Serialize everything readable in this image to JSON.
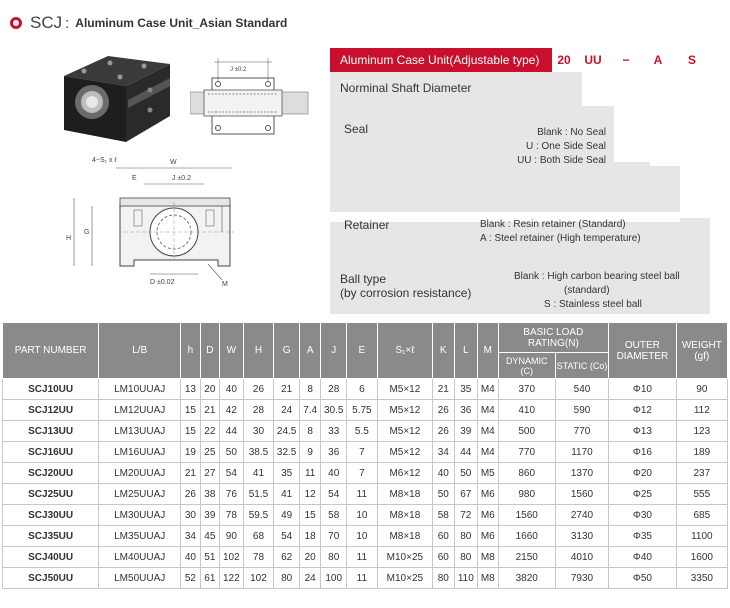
{
  "header": {
    "title": "SCJ",
    "separator": ":",
    "subtitle": "Aluminum Case Unit_Asian Standard"
  },
  "drawing": {
    "labels": {
      "j2": "J ±0.2",
      "four_s": "4−S₁ x ℓ",
      "w": "W",
      "e": "E",
      "j": "J ±0.2",
      "h1": "h ±0.02",
      "g": "G",
      "h": "H",
      "d": "D ±0.02",
      "m": "M"
    }
  },
  "code": {
    "red_label": "Aluminum Case Unit(Adjustable type) SC",
    "segments": [
      "20",
      "UU",
      "−",
      "A",
      "S"
    ],
    "shaft_label": "Norminal Shaft Diameter",
    "seal_label": "Seal",
    "seal_options": [
      "Blank : No Seal",
      "U : One Side Seal",
      "UU : Both Side Seal"
    ],
    "retainer_label": "Retainer",
    "retainer_options": [
      "Blank : Resin retainer (Standard)",
      "A : Steel retainer (High temperature)"
    ],
    "ball_label_1": "Ball type",
    "ball_label_2": "(by corrosion resistance)",
    "ball_options": [
      "Blank : High carbon bearing steel ball",
      "(standard)",
      "S : Stainless steel ball"
    ]
  },
  "table": {
    "headers": {
      "part": "PART NUMBER",
      "lb": "L/B",
      "h": "h",
      "d": "D",
      "w": "W",
      "hh": "H",
      "g": "G",
      "a": "A",
      "j": "J",
      "e": "E",
      "s1": "S₁×ℓ",
      "k": "K",
      "l": "L",
      "m": "M",
      "load": "BASIC LOAD RATING(N)",
      "dynamic": "DYNAMIC (C)",
      "static": "STATIC (Co)",
      "outer": "OUTER DIAMETER",
      "weight": "WEIGHT (gf)"
    },
    "rows": [
      [
        "SCJ10UU",
        "LM10UUAJ",
        "13",
        "20",
        "40",
        "26",
        "21",
        "8",
        "28",
        "6",
        "M5×12",
        "21",
        "35",
        "M4",
        "370",
        "540",
        "Φ10",
        "90"
      ],
      [
        "SCJ12UU",
        "LM12UUAJ",
        "15",
        "21",
        "42",
        "28",
        "24",
        "7.4",
        "30.5",
        "5.75",
        "M5×12",
        "26",
        "36",
        "M4",
        "410",
        "590",
        "Φ12",
        "112"
      ],
      [
        "SCJ13UU",
        "LM13UUAJ",
        "15",
        "22",
        "44",
        "30",
        "24.5",
        "8",
        "33",
        "5.5",
        "M5×12",
        "26",
        "39",
        "M4",
        "500",
        "770",
        "Φ13",
        "123"
      ],
      [
        "SCJ16UU",
        "LM16UUAJ",
        "19",
        "25",
        "50",
        "38.5",
        "32.5",
        "9",
        "36",
        "7",
        "M5×12",
        "34",
        "44",
        "M4",
        "770",
        "1170",
        "Φ16",
        "189"
      ],
      [
        "SCJ20UU",
        "LM20UUAJ",
        "21",
        "27",
        "54",
        "41",
        "35",
        "11",
        "40",
        "7",
        "M6×12",
        "40",
        "50",
        "M5",
        "860",
        "1370",
        "Φ20",
        "237"
      ],
      [
        "SCJ25UU",
        "LM25UUAJ",
        "26",
        "38",
        "76",
        "51.5",
        "41",
        "12",
        "54",
        "11",
        "M8×18",
        "50",
        "67",
        "M6",
        "980",
        "1560",
        "Φ25",
        "555"
      ],
      [
        "SCJ30UU",
        "LM30UUAJ",
        "30",
        "39",
        "78",
        "59.5",
        "49",
        "15",
        "58",
        "10",
        "M8×18",
        "58",
        "72",
        "M6",
        "1560",
        "2740",
        "Φ30",
        "685"
      ],
      [
        "SCJ35UU",
        "LM35UUAJ",
        "34",
        "45",
        "90",
        "68",
        "54",
        "18",
        "70",
        "10",
        "M8×18",
        "60",
        "80",
        "M6",
        "1660",
        "3130",
        "Φ35",
        "1100"
      ],
      [
        "SCJ40UU",
        "LM40UUAJ",
        "40",
        "51",
        "102",
        "78",
        "62",
        "20",
        "80",
        "11",
        "M10×25",
        "60",
        "80",
        "M8",
        "2150",
        "4010",
        "Φ40",
        "1600"
      ],
      [
        "SCJ50UU",
        "LM50UUAJ",
        "52",
        "61",
        "122",
        "102",
        "80",
        "24",
        "100",
        "11",
        "M10×25",
        "80",
        "110",
        "M8",
        "3820",
        "7930",
        "Φ50",
        "3350"
      ]
    ]
  }
}
